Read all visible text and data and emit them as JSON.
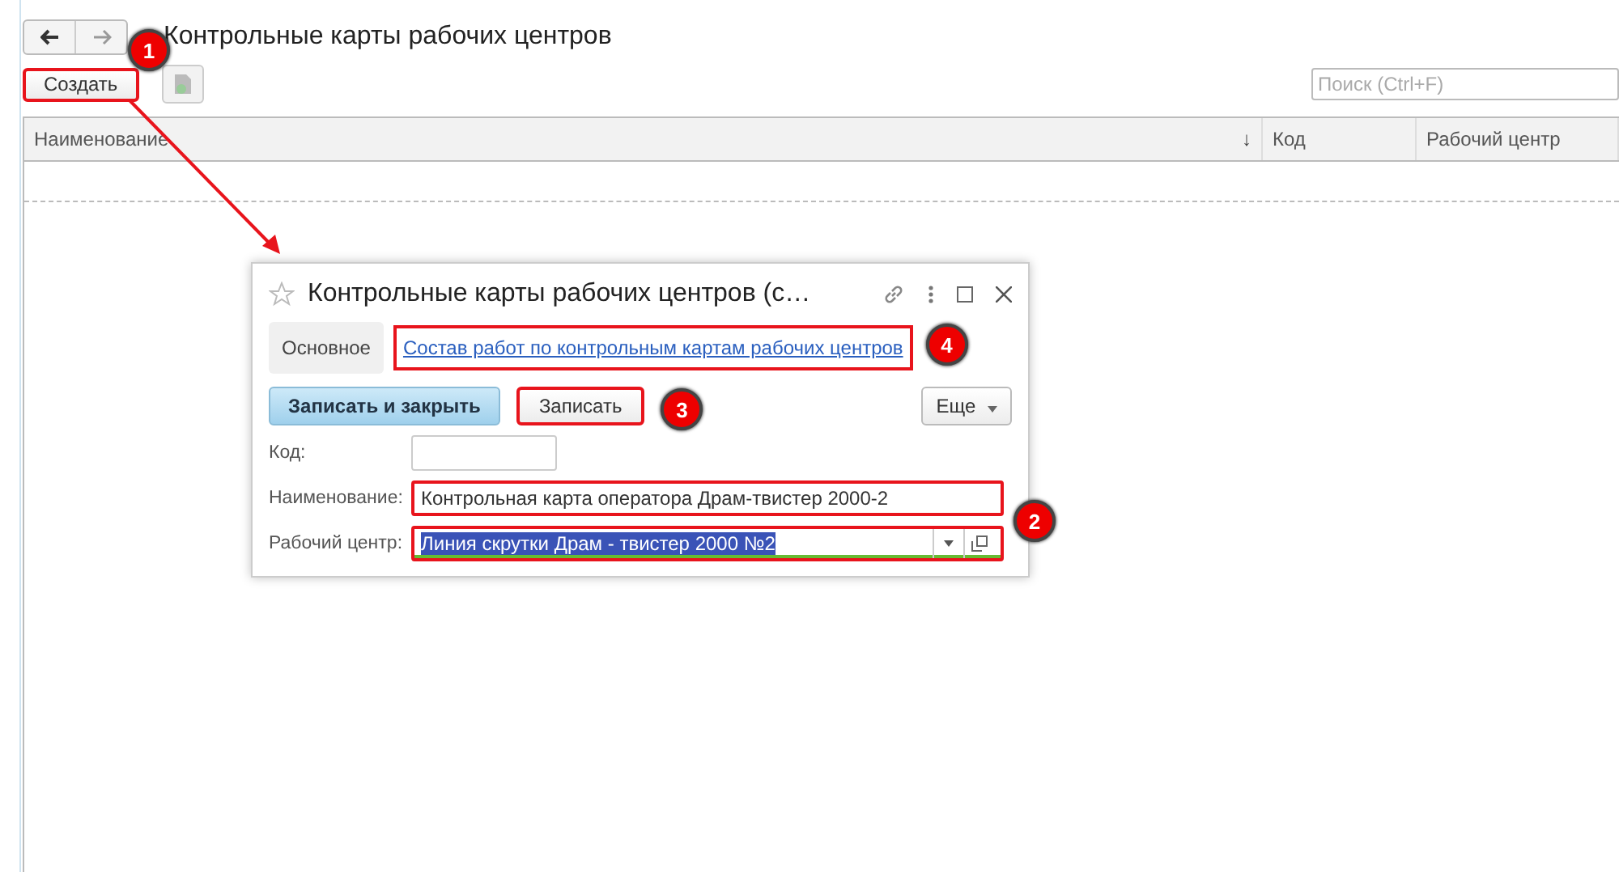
{
  "window": {
    "title": "Контрольные карты рабочих центров"
  },
  "toolbar": {
    "create_button": {
      "label": "Создать",
      "highlighted": true,
      "callout": "1"
    },
    "search": {
      "placeholder": "Поиск (Ctrl+F)"
    }
  },
  "table": {
    "sort_mark": "↓",
    "columns": [
      {
        "label": "Наименование",
        "sorted": true
      },
      {
        "label": "Код",
        "sorted": false
      },
      {
        "label": "Рабочий центр",
        "sorted": false
      }
    ]
  },
  "dialog": {
    "title": "Контрольные карты рабочих центров (с…",
    "tabs": [
      {
        "label": "Основное",
        "selected": true,
        "kind": "tab",
        "highlighted": false
      },
      {
        "label": "Состав работ по контрольным картам рабочих центров",
        "selected": false,
        "kind": "link",
        "highlighted": true,
        "callout": "4"
      }
    ],
    "buttons": [
      {
        "label": "Записать и закрыть",
        "kind": "primary",
        "highlighted": false
      },
      {
        "label": "Записать",
        "kind": "default",
        "highlighted": true,
        "callout": "3"
      },
      {
        "label": "Еще",
        "kind": "menu",
        "highlighted": false
      }
    ],
    "fields_callout": "2",
    "fields": [
      {
        "label": "Код:",
        "kind": "short",
        "highlighted": false,
        "focused": false
      },
      {
        "label": "Наименование:",
        "value": "Контрольная карта оператора Драм-твистер 2000-2",
        "kind": "text",
        "highlighted": true,
        "focused": false
      },
      {
        "label": "Рабочий центр:",
        "value": "Линия скрутки Драм - твистер 2000 №2",
        "kind": "select",
        "highlighted": true,
        "focused": true,
        "text_selected": true
      }
    ]
  }
}
